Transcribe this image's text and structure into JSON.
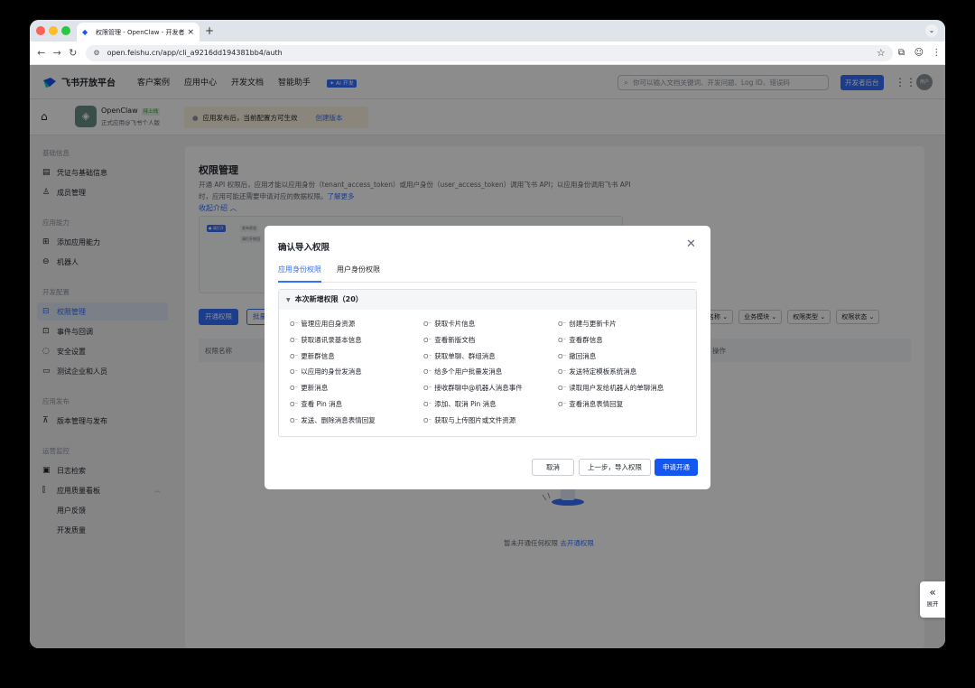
{
  "browser": {
    "tab_title": "权限管理 - OpenClaw - 开发者",
    "tab_close": "×",
    "new_tab": "+",
    "url": "open.feishu.cn/app/cli_a9216dd194381bb4/auth"
  },
  "header": {
    "brand": "飞书开放平台",
    "nav": [
      "客户案例",
      "应用中心",
      "开发文档",
      "智能助手"
    ],
    "ai_badge": "✦ AI 开发",
    "search_placeholder": "你可以输入文档关键词、开发问题、Log ID、错误码",
    "dev_console": "开发者后台",
    "avatar_text": "用户"
  },
  "app": {
    "name": "OpenClaw",
    "status": "待上线",
    "subtitle": "正式应用@飞书个人版",
    "notice": "应用发布后，当前配置方可生效",
    "create_version": "创建版本"
  },
  "sidebar": {
    "groups": {
      "basic": "基础信息",
      "abilities": "应用能力",
      "dev_config": "开发配置",
      "publish": "应用发布",
      "ops": "运营监控"
    },
    "items": {
      "credentials": "凭证与基础信息",
      "members": "成员管理",
      "add_ability": "添加应用能力",
      "bot": "机器人",
      "permissions": "权限管理",
      "events": "事件与回调",
      "security": "安全设置",
      "test_company": "测试企业和人员",
      "versions": "版本管理与发布",
      "logs": "日志检索",
      "quality": "应用质量看板",
      "feedback": "用户反馈",
      "dev_quality": "开发质量"
    }
  },
  "page": {
    "title": "权限管理",
    "description": "开通 API 权限后，应用才能以应用身份（tenant_access_token）或用户身份（user_access_token）调用飞书 API；以应用身份调用飞书 API 时，应用可能还需要申请对应的数据权限。",
    "learn_more": "了解更多",
    "collapse": "收起介绍 ︿",
    "open_permissions_btn": "开通权限",
    "batch_btn": "批量",
    "filters": [
      "名称 ⌄",
      "业务模块 ⌄",
      "权限类型 ⌄",
      "权限状态 ⌄"
    ],
    "col_name": "权限名称",
    "col_action": "操作",
    "empty_text": "暂未开通任何权限",
    "empty_link": "去开通权限",
    "illus_chips": [
      "● 请打开",
      "发布状态",
      "请打开按钮"
    ]
  },
  "dialog": {
    "title": "确认导入权限",
    "tabs": [
      "应用身份权限",
      "用户身份权限"
    ],
    "section": "本次新增权限（20）",
    "permissions": [
      "管理应用自身资源",
      "获取卡片信息",
      "创建与更新卡片",
      "获取通讯录基本信息",
      "查看新版文档",
      "查看群信息",
      "更新群信息",
      "获取单聊、群组消息",
      "撤回消息",
      "以应用的身份发消息",
      "给多个用户批量发消息",
      "发送特定模板系统消息",
      "更新消息",
      "接收群聊中@机器人消息事件",
      "读取用户发给机器人的单聊消息",
      "查看 Pin 消息",
      "添加、取消 Pin 消息",
      "查看消息表情回复",
      "发送、删除消息表情回复",
      "获取与上传图片或文件资源"
    ],
    "cancel": "取消",
    "prev": "上一步，导入权限",
    "apply": "申请开通"
  },
  "expand_label": "展开",
  "colors": {
    "accent": "#3370ff",
    "primary_button": "#1456f0"
  }
}
